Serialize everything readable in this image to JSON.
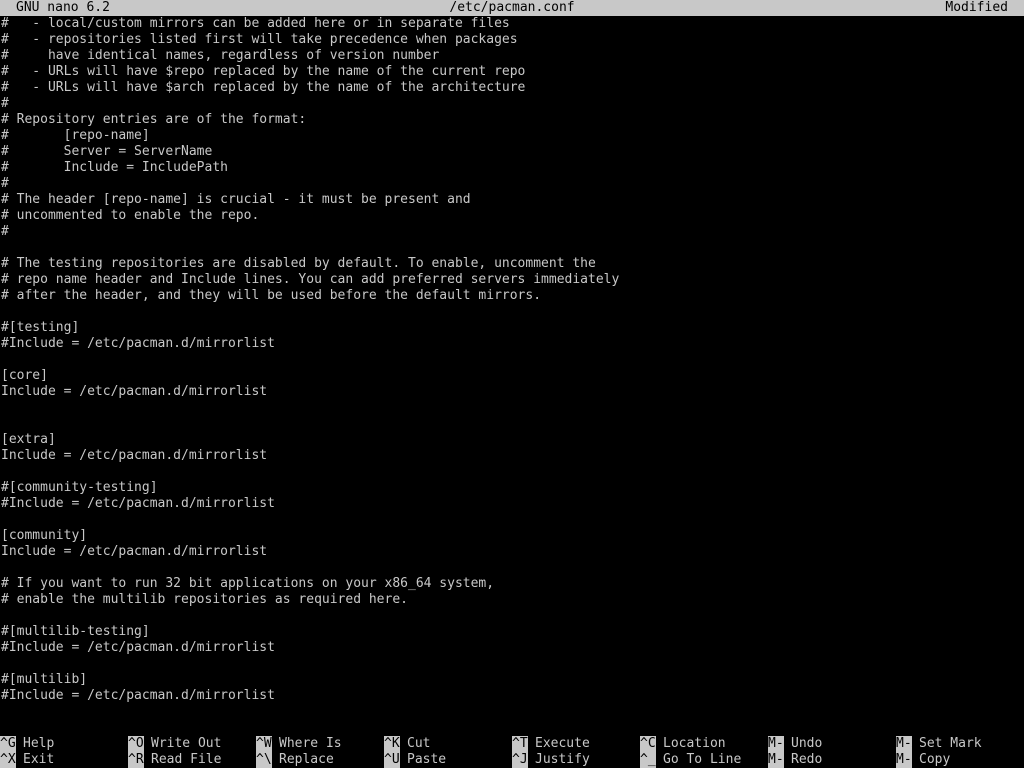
{
  "title": {
    "app": "GNU nano 6.2",
    "file": "/etc/pacman.conf",
    "status": "Modified"
  },
  "lines": [
    "#   - local/custom mirrors can be added here or in separate files",
    "#   - repositories listed first will take precedence when packages",
    "#     have identical names, regardless of version number",
    "#   - URLs will have $repo replaced by the name of the current repo",
    "#   - URLs will have $arch replaced by the name of the architecture",
    "#",
    "# Repository entries are of the format:",
    "#       [repo-name]",
    "#       Server = ServerName",
    "#       Include = IncludePath",
    "#",
    "# The header [repo-name] is crucial - it must be present and",
    "# uncommented to enable the repo.",
    "#",
    "",
    "# The testing repositories are disabled by default. To enable, uncomment the",
    "# repo name header and Include lines. You can add preferred servers immediately",
    "# after the header, and they will be used before the default mirrors.",
    "",
    "#[testing]",
    "#Include = /etc/pacman.d/mirrorlist",
    "",
    "[core]",
    "Include = /etc/pacman.d/mirrorlist",
    "",
    "",
    "[extra]",
    "Include = /etc/pacman.d/mirrorlist",
    "",
    "#[community-testing]",
    "#Include = /etc/pacman.d/mirrorlist",
    "",
    "[community]",
    "Include = /etc/pacman.d/mirrorlist",
    "",
    "# If you want to run 32 bit applications on your x86_64 system,",
    "# enable the multilib repositories as required here.",
    "",
    "#[multilib-testing]",
    "#Include = /etc/pacman.d/mirrorlist",
    "",
    "#[multilib]",
    "#Include = /etc/pacman.d/mirrorlist"
  ],
  "shortcuts": [
    {
      "key": "^G",
      "label": "Help"
    },
    {
      "key": "^X",
      "label": "Exit"
    },
    {
      "key": "^O",
      "label": "Write Out"
    },
    {
      "key": "^R",
      "label": "Read File"
    },
    {
      "key": "^W",
      "label": "Where Is"
    },
    {
      "key": "^\\",
      "label": "Replace"
    },
    {
      "key": "^K",
      "label": "Cut"
    },
    {
      "key": "^U",
      "label": "Paste"
    },
    {
      "key": "^T",
      "label": "Execute"
    },
    {
      "key": "^J",
      "label": "Justify"
    },
    {
      "key": "^C",
      "label": "Location"
    },
    {
      "key": "^_",
      "label": "Go To Line"
    },
    {
      "key": "M-U",
      "label": "Undo"
    },
    {
      "key": "M-E",
      "label": "Redo"
    },
    {
      "key": "M-A",
      "label": "Set Mark"
    },
    {
      "key": "M-6",
      "label": "Copy"
    }
  ],
  "colors": {
    "background": "#000000",
    "foreground": "#c8c8c8",
    "inverse_bg": "#c8c8c8",
    "inverse_fg": "#000000"
  }
}
